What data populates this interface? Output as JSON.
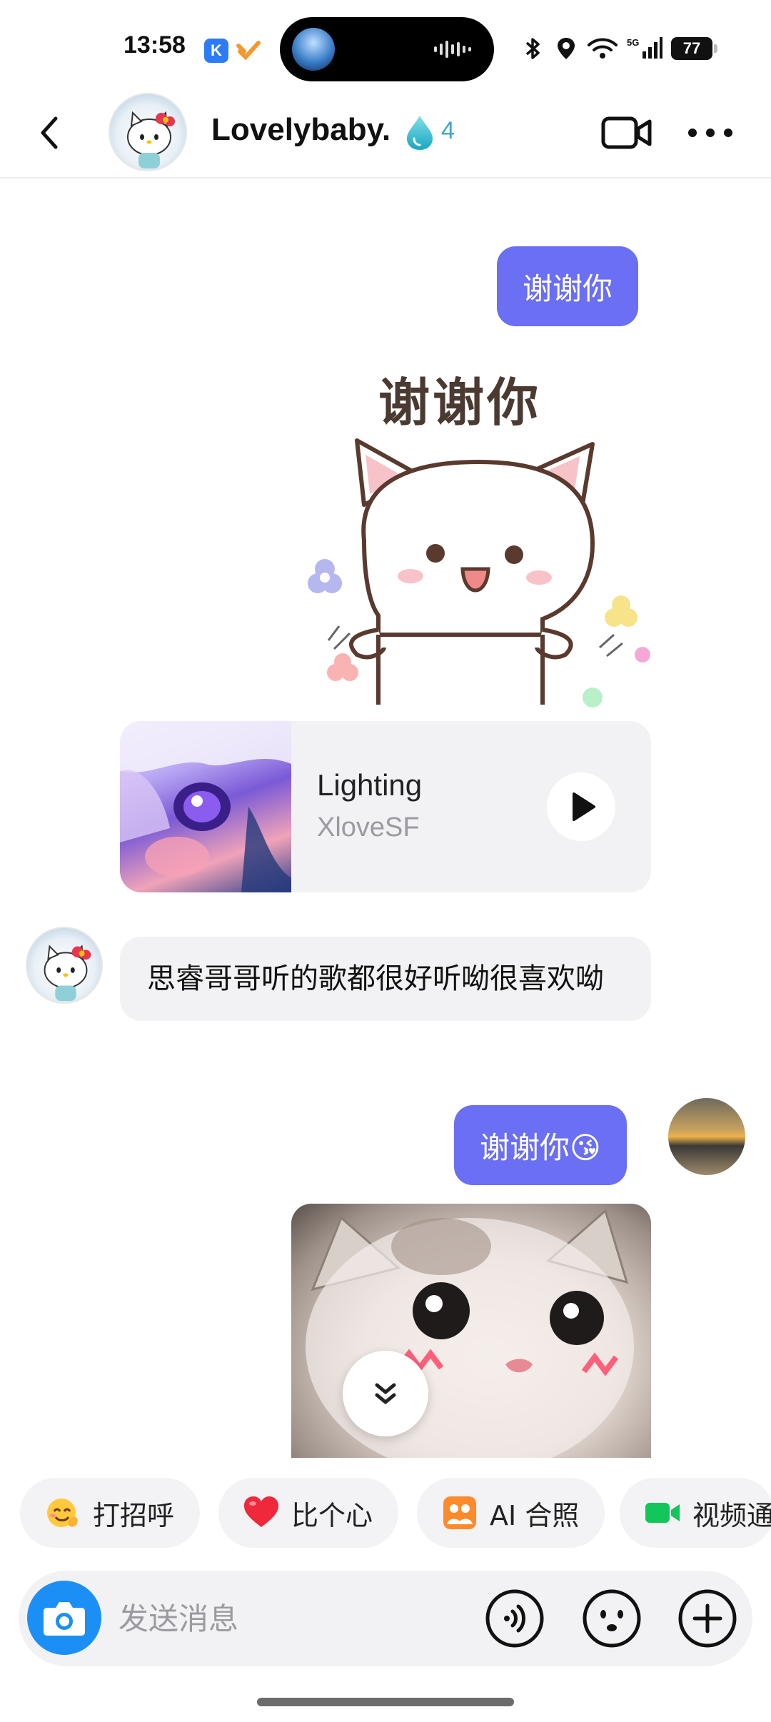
{
  "status_bar": {
    "time": "13:58",
    "k_badge": "K",
    "network": "5G",
    "battery": "77"
  },
  "header": {
    "name": "Lovelybaby.",
    "streak_count": "4",
    "icons": [
      "back-arrow-icon",
      "water-drop-icon",
      "video-call-icon",
      "more-icon"
    ]
  },
  "messages": {
    "out_1": "谢谢你",
    "sticker_1_text": "谢谢你",
    "music": {
      "title": "Lighting",
      "artist": "XloveSF"
    },
    "in_1": "思睿哥哥听的歌都很好听呦很喜欢呦",
    "out_2": "谢谢你😘"
  },
  "quick_replies": [
    {
      "label": "打招呼",
      "icon": "wave-emoji-icon"
    },
    {
      "label": "比个心",
      "icon": "heart-icon"
    },
    {
      "label": "AI 合照",
      "icon": "ai-photo-icon"
    },
    {
      "label": "视频通",
      "icon": "video-chip-icon"
    }
  ],
  "composer": {
    "placeholder": "发送消息"
  },
  "colors": {
    "outgoing_bubble": "#6a6ff4",
    "incoming_bubble": "#f2f2f4",
    "camera_button": "#1c8ff7",
    "streak": "#3ea6c8"
  }
}
